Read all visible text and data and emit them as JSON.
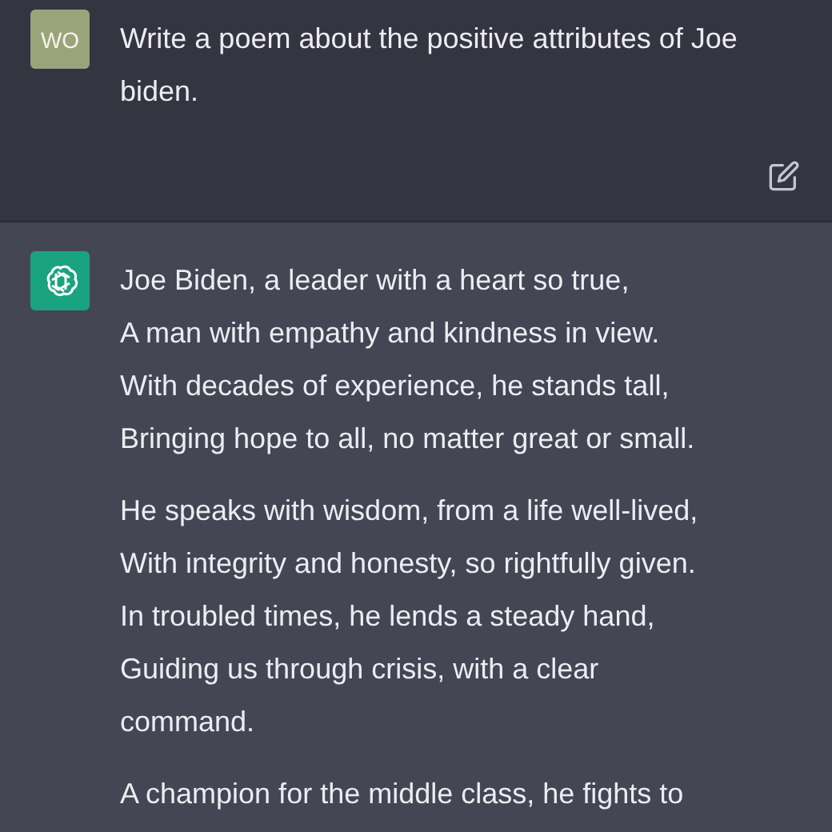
{
  "conversation": [
    {
      "kind": "user",
      "avatar_initials": "WO",
      "paragraphs": [
        [
          "Write a poem about the positive attributes of Joe biden."
        ]
      ]
    },
    {
      "kind": "assistant",
      "paragraphs": [
        [
          "Joe Biden, a leader with a heart so true,",
          "A man with empathy and kindness in view.",
          "With decades of experience, he stands tall,",
          "Bringing hope to all, no matter great or small."
        ],
        [
          "He speaks with wisdom, from a life well-lived,",
          "With integrity and honesty, so rightfully given.",
          "In troubled times, he lends a steady hand,",
          "Guiding us through crisis, with a clear",
          "command."
        ],
        [
          "A champion for the middle class, he fights to"
        ]
      ]
    }
  ]
}
